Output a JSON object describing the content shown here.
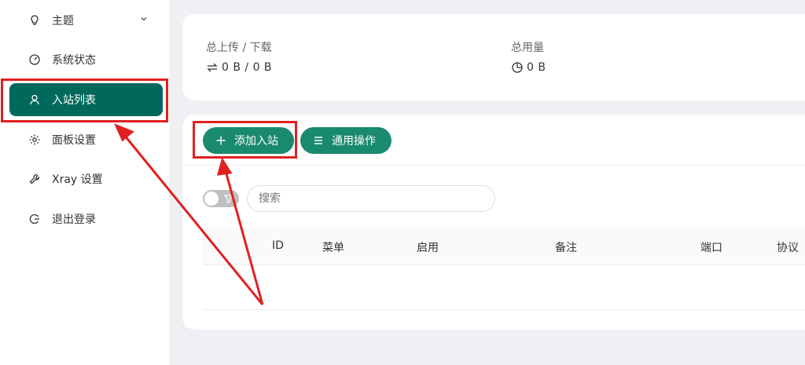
{
  "sidebar": {
    "items": [
      {
        "label": "主题",
        "icon": "bulb-icon"
      },
      {
        "label": "系统状态",
        "icon": "dashboard-icon"
      },
      {
        "label": "入站列表",
        "icon": "user-icon"
      },
      {
        "label": "面板设置",
        "icon": "gear-icon"
      },
      {
        "label": "Xray 设置",
        "icon": "wrench-icon"
      },
      {
        "label": "退出登录",
        "icon": "logout-icon"
      }
    ]
  },
  "stats": {
    "upload_download_label": "总上传 / 下载",
    "upload_download_value": "0 B / 0 B",
    "usage_label": "总用量",
    "usage_value": "0 B"
  },
  "toolbar": {
    "add_inbound_label": "添加入站",
    "general_actions_label": "通用操作"
  },
  "search": {
    "placeholder": "搜索"
  },
  "table": {
    "columns": [
      "ID",
      "菜单",
      "启用",
      "备注",
      "端口",
      "协议"
    ]
  },
  "colors": {
    "accent": "#00695c",
    "button": "#1a8a6e",
    "annotation": "#e02020"
  }
}
